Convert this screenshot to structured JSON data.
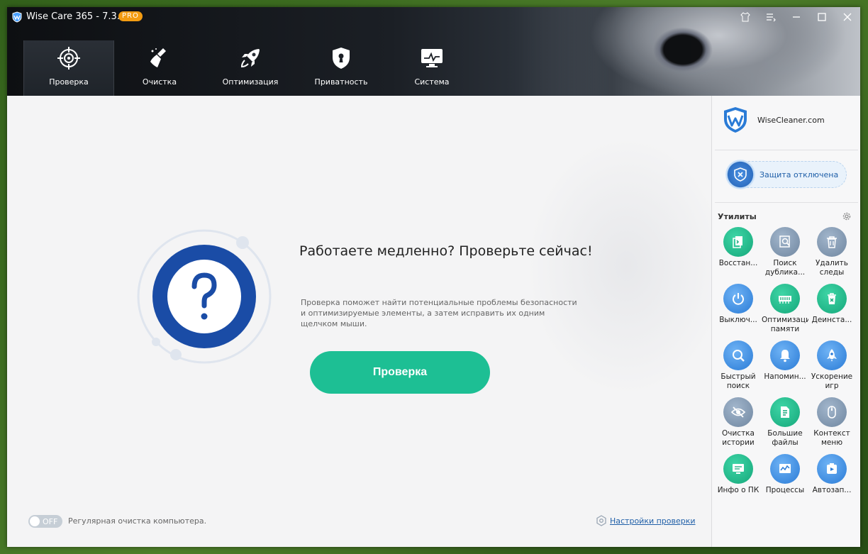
{
  "window": {
    "title": "Wise Care 365 - 7.3.5",
    "badge": "PRO"
  },
  "nav": {
    "tabs": [
      {
        "label": "Проверка",
        "icon": "target-icon"
      },
      {
        "label": "Очистка",
        "icon": "broom-icon"
      },
      {
        "label": "Оптимизация",
        "icon": "rocket-icon"
      },
      {
        "label": "Приватность",
        "icon": "keyhole-shield-icon"
      },
      {
        "label": "Система",
        "icon": "monitor-icon"
      }
    ],
    "active": 0
  },
  "main": {
    "headline": "Работаете медленно? Проверьте сейчас!",
    "description": "Проверка поможет найти потенциальные проблемы безопасности и оптимизируемые элементы, а затем исправить их одним щелчком мыши.",
    "scan_button": "Проверка",
    "toggle_state": "OFF",
    "auto_clean_label": "Регулярная очистка компьютера.",
    "scan_settings_link": "Настройки проверки"
  },
  "sidebar": {
    "brand": "WiseCleaner.com",
    "protection_status": "Защита отключена",
    "utilities_title": "Утилиты",
    "tools": [
      {
        "label": "Восстан...",
        "icon": "restore-icon",
        "color": "#1db987"
      },
      {
        "label": "Поиск дублика...",
        "icon": "duplicate-search-icon",
        "color": "#7b8fa6"
      },
      {
        "label": "Удалить следы",
        "icon": "trash-icon",
        "color": "#7b8fa6"
      },
      {
        "label": "Выключ...",
        "icon": "power-icon",
        "color": "#2a7bd6"
      },
      {
        "label": "Оптимизация памяти",
        "icon": "memory-icon",
        "color": "#1db987"
      },
      {
        "label": "Деинста...",
        "icon": "uninstall-icon",
        "color": "#1db987"
      },
      {
        "label": "Быстрый поиск",
        "icon": "search-icon",
        "color": "#2a7bd6"
      },
      {
        "label": "Напомин...",
        "icon": "bell-icon",
        "color": "#2a7bd6"
      },
      {
        "label": "Ускорение игр",
        "icon": "rocket-icon",
        "color": "#2a7bd6"
      },
      {
        "label": "Очистка истории",
        "icon": "eye-off-icon",
        "color": "#7b8fa6"
      },
      {
        "label": "Большие файлы",
        "icon": "files-icon",
        "color": "#1db987"
      },
      {
        "label": "Контекст меню",
        "icon": "mouse-icon",
        "color": "#7b8fa6"
      },
      {
        "label": "Инфо о ПК",
        "icon": "pc-info-icon",
        "color": "#1db987"
      },
      {
        "label": "Процессы",
        "icon": "process-icon",
        "color": "#2a7bd6"
      },
      {
        "label": "Автозап...",
        "icon": "autostart-icon",
        "color": "#2a7bd6"
      }
    ]
  }
}
